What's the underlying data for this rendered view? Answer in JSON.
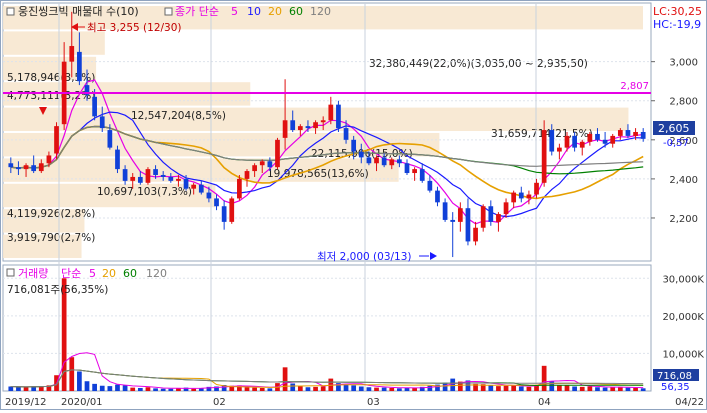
{
  "legend_top": {
    "name": "웅진씽크빅 매물대 수(10)",
    "ma_label": "종가 단순",
    "ma_periods": [
      "5",
      "10",
      "20",
      "60",
      "120"
    ],
    "ma_colors": [
      "#e600e6",
      "#1a1aff",
      "#e6a000",
      "#008000",
      "#7f7f7f"
    ]
  },
  "legend_bottom": {
    "name": "거래량",
    "ma_label": "단순",
    "ma_periods": [
      "5",
      "20",
      "60",
      "120"
    ],
    "ma_colors": [
      "#e600e6",
      "#e6a000",
      "#008000",
      "#7f7f7f"
    ]
  },
  "right_info": {
    "lc": "LC:30,25",
    "hc": "HC:-19,9"
  },
  "annotations": {
    "high": "최고 3,255 (12/30)",
    "low": "최저 2,000 (03/13)",
    "resistance": "2,807",
    "last_price": "2,605",
    "last_change": "-0,57",
    "volume_last": "716,081주(56,35%)",
    "volume_tag": "716,08",
    "volume_pct_tag": "56,35"
  },
  "volume_profile": [
    {
      "label": "32,380,449(22,0%)(3,035,00 ~ 2,935,50)",
      "pct": 22.0
    },
    {
      "label": "5,178,946(3,5%)",
      "pct": 3.5
    },
    {
      "label": "4,773,111(3,2%)",
      "pct": 3.2
    },
    {
      "label": "12,547,204(8,5%)",
      "pct": 8.5
    },
    {
      "label": "31,659,714(21,5%)",
      "pct": 21.5
    },
    {
      "label": "22,115,006(15,0%)",
      "pct": 15.0
    },
    {
      "label": "19,978,565(13,6%)",
      "pct": 13.6
    },
    {
      "label": "10,697,103(7,3%)",
      "pct": 7.3
    },
    {
      "label": "4,119,926(2,8%)",
      "pct": 2.8
    },
    {
      "label": "3,919,790(2,7%)",
      "pct": 2.7
    }
  ],
  "chart_data": {
    "type": "candlestick",
    "price_axis": {
      "ticks": [
        2200,
        2400,
        2600,
        2800,
        3000
      ],
      "labels": [
        "2,200",
        "2,400",
        "2,600",
        "2,800",
        "3,000"
      ],
      "range": [
        1990,
        3290
      ]
    },
    "volume_axis": {
      "ticks": [
        10000,
        20000,
        30000
      ],
      "labels": [
        "10,000",
        "20,000",
        "30,000"
      ],
      "unit": "K",
      "range": [
        0,
        33000
      ]
    },
    "x_labels": [
      "2019/12",
      "2020/01",
      "02",
      "03",
      "04",
      "04/22"
    ],
    "candles": [
      {
        "o": 2480,
        "h": 2510,
        "l": 2430,
        "c": 2460,
        "v": 1200
      },
      {
        "o": 2460,
        "h": 2490,
        "l": 2420,
        "c": 2450,
        "v": 1100
      },
      {
        "o": 2450,
        "h": 2480,
        "l": 2410,
        "c": 2470,
        "v": 1000
      },
      {
        "o": 2470,
        "h": 2520,
        "l": 2430,
        "c": 2440,
        "v": 1300
      },
      {
        "o": 2440,
        "h": 2500,
        "l": 2430,
        "c": 2480,
        "v": 1200
      },
      {
        "o": 2480,
        "h": 2540,
        "l": 2460,
        "c": 2520,
        "v": 1500
      },
      {
        "o": 2530,
        "h": 2690,
        "l": 2500,
        "c": 2670,
        "v": 4200
      },
      {
        "o": 2680,
        "h": 3100,
        "l": 2650,
        "c": 3000,
        "v": 30000
      },
      {
        "o": 3000,
        "h": 3255,
        "l": 2920,
        "c": 3080,
        "v": 9000
      },
      {
        "o": 3050,
        "h": 3150,
        "l": 2880,
        "c": 2900,
        "v": 5200
      },
      {
        "o": 2880,
        "h": 2960,
        "l": 2800,
        "c": 2830,
        "v": 2600
      },
      {
        "o": 2820,
        "h": 2860,
        "l": 2700,
        "c": 2720,
        "v": 1900
      },
      {
        "o": 2720,
        "h": 2770,
        "l": 2640,
        "c": 2660,
        "v": 1400
      },
      {
        "o": 2650,
        "h": 2680,
        "l": 2550,
        "c": 2560,
        "v": 1300
      },
      {
        "o": 2550,
        "h": 2570,
        "l": 2430,
        "c": 2450,
        "v": 1700
      },
      {
        "o": 2450,
        "h": 2470,
        "l": 2370,
        "c": 2390,
        "v": 1500
      },
      {
        "o": 2390,
        "h": 2430,
        "l": 2350,
        "c": 2410,
        "v": 900
      },
      {
        "o": 2410,
        "h": 2440,
        "l": 2370,
        "c": 2380,
        "v": 800
      },
      {
        "o": 2380,
        "h": 2460,
        "l": 2370,
        "c": 2450,
        "v": 1000
      },
      {
        "o": 2450,
        "h": 2470,
        "l": 2400,
        "c": 2420,
        "v": 700
      },
      {
        "o": 2420,
        "h": 2440,
        "l": 2390,
        "c": 2410,
        "v": 600
      },
      {
        "o": 2410,
        "h": 2430,
        "l": 2380,
        "c": 2390,
        "v": 600
      },
      {
        "o": 2390,
        "h": 2420,
        "l": 2360,
        "c": 2400,
        "v": 700
      },
      {
        "o": 2400,
        "h": 2420,
        "l": 2340,
        "c": 2350,
        "v": 900
      },
      {
        "o": 2350,
        "h": 2380,
        "l": 2320,
        "c": 2370,
        "v": 600
      },
      {
        "o": 2370,
        "h": 2390,
        "l": 2320,
        "c": 2330,
        "v": 800
      },
      {
        "o": 2330,
        "h": 2360,
        "l": 2280,
        "c": 2300,
        "v": 1100
      },
      {
        "o": 2300,
        "h": 2320,
        "l": 2240,
        "c": 2260,
        "v": 1200
      },
      {
        "o": 2260,
        "h": 2290,
        "l": 2140,
        "c": 2180,
        "v": 1600
      },
      {
        "o": 2180,
        "h": 2310,
        "l": 2170,
        "c": 2300,
        "v": 1400
      },
      {
        "o": 2300,
        "h": 2420,
        "l": 2290,
        "c": 2400,
        "v": 1500
      },
      {
        "o": 2400,
        "h": 2450,
        "l": 2360,
        "c": 2440,
        "v": 1000
      },
      {
        "o": 2440,
        "h": 2480,
        "l": 2410,
        "c": 2470,
        "v": 900
      },
      {
        "o": 2470,
        "h": 2500,
        "l": 2430,
        "c": 2490,
        "v": 800
      },
      {
        "o": 2490,
        "h": 2510,
        "l": 2440,
        "c": 2460,
        "v": 700
      },
      {
        "o": 2460,
        "h": 2610,
        "l": 2450,
        "c": 2600,
        "v": 2100
      },
      {
        "o": 2610,
        "h": 2910,
        "l": 2550,
        "c": 2700,
        "v": 6300
      },
      {
        "o": 2700,
        "h": 2750,
        "l": 2640,
        "c": 2650,
        "v": 2000
      },
      {
        "o": 2650,
        "h": 2680,
        "l": 2620,
        "c": 2670,
        "v": 1200
      },
      {
        "o": 2670,
        "h": 2700,
        "l": 2640,
        "c": 2660,
        "v": 1000
      },
      {
        "o": 2660,
        "h": 2700,
        "l": 2630,
        "c": 2690,
        "v": 1100
      },
      {
        "o": 2690,
        "h": 2720,
        "l": 2650,
        "c": 2700,
        "v": 1200
      },
      {
        "o": 2700,
        "h": 2820,
        "l": 2680,
        "c": 2780,
        "v": 3300
      },
      {
        "o": 2780,
        "h": 2800,
        "l": 2640,
        "c": 2660,
        "v": 2100
      },
      {
        "o": 2660,
        "h": 2700,
        "l": 2580,
        "c": 2600,
        "v": 1600
      },
      {
        "o": 2600,
        "h": 2620,
        "l": 2500,
        "c": 2540,
        "v": 1500
      },
      {
        "o": 2540,
        "h": 2580,
        "l": 2480,
        "c": 2510,
        "v": 1200
      },
      {
        "o": 2510,
        "h": 2540,
        "l": 2470,
        "c": 2480,
        "v": 1000
      },
      {
        "o": 2480,
        "h": 2520,
        "l": 2440,
        "c": 2510,
        "v": 900
      },
      {
        "o": 2510,
        "h": 2530,
        "l": 2460,
        "c": 2470,
        "v": 900
      },
      {
        "o": 2470,
        "h": 2510,
        "l": 2450,
        "c": 2500,
        "v": 800
      },
      {
        "o": 2500,
        "h": 2520,
        "l": 2460,
        "c": 2480,
        "v": 700
      },
      {
        "o": 2480,
        "h": 2500,
        "l": 2420,
        "c": 2430,
        "v": 900
      },
      {
        "o": 2430,
        "h": 2460,
        "l": 2390,
        "c": 2450,
        "v": 800
      },
      {
        "o": 2450,
        "h": 2480,
        "l": 2380,
        "c": 2390,
        "v": 1100
      },
      {
        "o": 2390,
        "h": 2420,
        "l": 2330,
        "c": 2340,
        "v": 1400
      },
      {
        "o": 2340,
        "h": 2360,
        "l": 2260,
        "c": 2280,
        "v": 1700
      },
      {
        "o": 2280,
        "h": 2300,
        "l": 2180,
        "c": 2190,
        "v": 2200
      },
      {
        "o": 2190,
        "h": 2230,
        "l": 2000,
        "c": 2180,
        "v": 3300
      },
      {
        "o": 2180,
        "h": 2280,
        "l": 2130,
        "c": 2250,
        "v": 2500
      },
      {
        "o": 2250,
        "h": 2300,
        "l": 2060,
        "c": 2080,
        "v": 2800
      },
      {
        "o": 2080,
        "h": 2180,
        "l": 2060,
        "c": 2150,
        "v": 1900
      },
      {
        "o": 2150,
        "h": 2270,
        "l": 2130,
        "c": 2260,
        "v": 1800
      },
      {
        "o": 2260,
        "h": 2290,
        "l": 2160,
        "c": 2180,
        "v": 1500
      },
      {
        "o": 2180,
        "h": 2230,
        "l": 2130,
        "c": 2220,
        "v": 1300
      },
      {
        "o": 2220,
        "h": 2300,
        "l": 2200,
        "c": 2280,
        "v": 1400
      },
      {
        "o": 2280,
        "h": 2340,
        "l": 2250,
        "c": 2330,
        "v": 1500
      },
      {
        "o": 2330,
        "h": 2360,
        "l": 2280,
        "c": 2300,
        "v": 1200
      },
      {
        "o": 2300,
        "h": 2340,
        "l": 2270,
        "c": 2320,
        "v": 1100
      },
      {
        "o": 2320,
        "h": 2400,
        "l": 2300,
        "c": 2380,
        "v": 1600
      },
      {
        "o": 2380,
        "h": 2700,
        "l": 2360,
        "c": 2650,
        "v": 6700
      },
      {
        "o": 2650,
        "h": 2680,
        "l": 2520,
        "c": 2540,
        "v": 2600
      },
      {
        "o": 2540,
        "h": 2580,
        "l": 2500,
        "c": 2560,
        "v": 1500
      },
      {
        "o": 2560,
        "h": 2640,
        "l": 2540,
        "c": 2620,
        "v": 1600
      },
      {
        "o": 2620,
        "h": 2640,
        "l": 2540,
        "c": 2560,
        "v": 1200
      },
      {
        "o": 2560,
        "h": 2600,
        "l": 2520,
        "c": 2590,
        "v": 1100
      },
      {
        "o": 2590,
        "h": 2640,
        "l": 2570,
        "c": 2630,
        "v": 1200
      },
      {
        "o": 2630,
        "h": 2660,
        "l": 2590,
        "c": 2600,
        "v": 1000
      },
      {
        "o": 2600,
        "h": 2640,
        "l": 2560,
        "c": 2580,
        "v": 900
      },
      {
        "o": 2580,
        "h": 2630,
        "l": 2560,
        "c": 2620,
        "v": 1000
      },
      {
        "o": 2620,
        "h": 2660,
        "l": 2600,
        "c": 2650,
        "v": 1100
      },
      {
        "o": 2650,
        "h": 2680,
        "l": 2610,
        "c": 2620,
        "v": 900
      },
      {
        "o": 2620,
        "h": 2660,
        "l": 2600,
        "c": 2640,
        "v": 800
      },
      {
        "o": 2640,
        "h": 2660,
        "l": 2590,
        "c": 2605,
        "v": 716
      }
    ],
    "up_color": "#e01010",
    "down_color": "#1040d8"
  }
}
